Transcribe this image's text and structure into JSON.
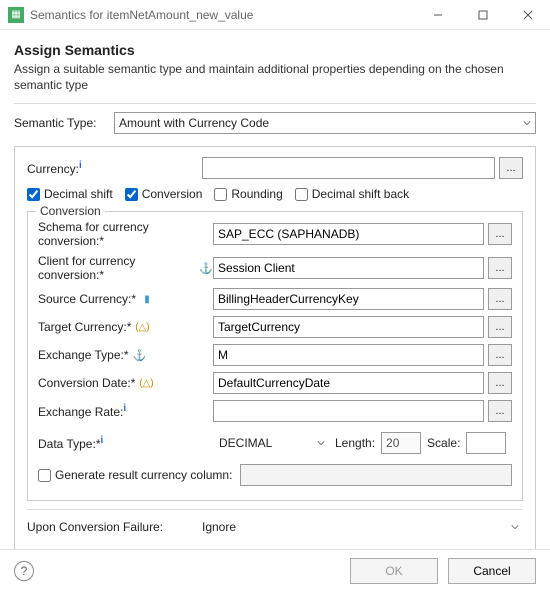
{
  "window": {
    "title": "Semantics for itemNetAmount_new_value"
  },
  "header": {
    "title": "Assign Semantics",
    "desc": "Assign a suitable semantic type and maintain additional properties depending on the chosen semantic type"
  },
  "semanticType": {
    "label": "Semantic Type:",
    "value": "Amount with Currency Code"
  },
  "currency": {
    "label": "Currency:",
    "value": ""
  },
  "checks": {
    "decimalShift": {
      "label": "Decimal shift",
      "checked": true
    },
    "conversion": {
      "label": "Conversion",
      "checked": true
    },
    "rounding": {
      "label": "Rounding",
      "checked": false
    },
    "decimalShiftBack": {
      "label": "Decimal shift back",
      "checked": false
    }
  },
  "conversion": {
    "legend": "Conversion",
    "schema": {
      "label": "Schema for currency conversion:*",
      "value": "SAP_ECC (SAPHANADB)"
    },
    "client": {
      "label": "Client for currency conversion:*",
      "value": "Session Client"
    },
    "sourceCurrency": {
      "label": "Source Currency:*",
      "value": "BillingHeaderCurrencyKey"
    },
    "targetCurrency": {
      "label": "Target Currency:*",
      "value": "TargetCurrency"
    },
    "exchangeType": {
      "label": "Exchange Type:*",
      "value": "M"
    },
    "conversionDate": {
      "label": "Conversion Date:*",
      "value": "DefaultCurrencyDate"
    },
    "exchangeRate": {
      "label": "Exchange Rate:",
      "value": ""
    }
  },
  "dataType": {
    "label": "Data Type:*",
    "value": "DECIMAL",
    "lengthLabel": "Length:",
    "length": "20",
    "scaleLabel": "Scale:",
    "scale": ""
  },
  "generate": {
    "label": "Generate result currency column:",
    "checked": false,
    "value": ""
  },
  "uponFail": {
    "label": "Upon Conversion Failure:",
    "value": "Ignore"
  },
  "buttons": {
    "ok": "OK",
    "cancel": "Cancel"
  }
}
